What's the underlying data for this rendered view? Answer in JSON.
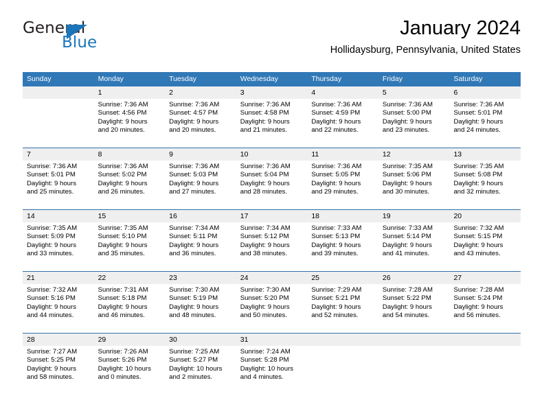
{
  "logo": {
    "word1": "General",
    "word2": "Blue",
    "triangle_color": "#1b75bb"
  },
  "header": {
    "title": "January 2024",
    "subtitle": "Hollidaysburg, Pennsylvania, United States"
  },
  "colors": {
    "header_blue": "#3178b7",
    "row_divider_blue": "#2f6fab",
    "daynum_band": "#efefef",
    "text": "#000000"
  },
  "weekdays": [
    "Sunday",
    "Monday",
    "Tuesday",
    "Wednesday",
    "Thursday",
    "Friday",
    "Saturday"
  ],
  "weeks": [
    [
      {
        "day": "",
        "sunrise": "",
        "sunset": "",
        "daylight1": "",
        "daylight2": ""
      },
      {
        "day": "1",
        "sunrise": "Sunrise: 7:36 AM",
        "sunset": "Sunset: 4:56 PM",
        "daylight1": "Daylight: 9 hours",
        "daylight2": "and 20 minutes."
      },
      {
        "day": "2",
        "sunrise": "Sunrise: 7:36 AM",
        "sunset": "Sunset: 4:57 PM",
        "daylight1": "Daylight: 9 hours",
        "daylight2": "and 20 minutes."
      },
      {
        "day": "3",
        "sunrise": "Sunrise: 7:36 AM",
        "sunset": "Sunset: 4:58 PM",
        "daylight1": "Daylight: 9 hours",
        "daylight2": "and 21 minutes."
      },
      {
        "day": "4",
        "sunrise": "Sunrise: 7:36 AM",
        "sunset": "Sunset: 4:59 PM",
        "daylight1": "Daylight: 9 hours",
        "daylight2": "and 22 minutes."
      },
      {
        "day": "5",
        "sunrise": "Sunrise: 7:36 AM",
        "sunset": "Sunset: 5:00 PM",
        "daylight1": "Daylight: 9 hours",
        "daylight2": "and 23 minutes."
      },
      {
        "day": "6",
        "sunrise": "Sunrise: 7:36 AM",
        "sunset": "Sunset: 5:01 PM",
        "daylight1": "Daylight: 9 hours",
        "daylight2": "and 24 minutes."
      }
    ],
    [
      {
        "day": "7",
        "sunrise": "Sunrise: 7:36 AM",
        "sunset": "Sunset: 5:01 PM",
        "daylight1": "Daylight: 9 hours",
        "daylight2": "and 25 minutes."
      },
      {
        "day": "8",
        "sunrise": "Sunrise: 7:36 AM",
        "sunset": "Sunset: 5:02 PM",
        "daylight1": "Daylight: 9 hours",
        "daylight2": "and 26 minutes."
      },
      {
        "day": "9",
        "sunrise": "Sunrise: 7:36 AM",
        "sunset": "Sunset: 5:03 PM",
        "daylight1": "Daylight: 9 hours",
        "daylight2": "and 27 minutes."
      },
      {
        "day": "10",
        "sunrise": "Sunrise: 7:36 AM",
        "sunset": "Sunset: 5:04 PM",
        "daylight1": "Daylight: 9 hours",
        "daylight2": "and 28 minutes."
      },
      {
        "day": "11",
        "sunrise": "Sunrise: 7:36 AM",
        "sunset": "Sunset: 5:05 PM",
        "daylight1": "Daylight: 9 hours",
        "daylight2": "and 29 minutes."
      },
      {
        "day": "12",
        "sunrise": "Sunrise: 7:35 AM",
        "sunset": "Sunset: 5:06 PM",
        "daylight1": "Daylight: 9 hours",
        "daylight2": "and 30 minutes."
      },
      {
        "day": "13",
        "sunrise": "Sunrise: 7:35 AM",
        "sunset": "Sunset: 5:08 PM",
        "daylight1": "Daylight: 9 hours",
        "daylight2": "and 32 minutes."
      }
    ],
    [
      {
        "day": "14",
        "sunrise": "Sunrise: 7:35 AM",
        "sunset": "Sunset: 5:09 PM",
        "daylight1": "Daylight: 9 hours",
        "daylight2": "and 33 minutes."
      },
      {
        "day": "15",
        "sunrise": "Sunrise: 7:35 AM",
        "sunset": "Sunset: 5:10 PM",
        "daylight1": "Daylight: 9 hours",
        "daylight2": "and 35 minutes."
      },
      {
        "day": "16",
        "sunrise": "Sunrise: 7:34 AM",
        "sunset": "Sunset: 5:11 PM",
        "daylight1": "Daylight: 9 hours",
        "daylight2": "and 36 minutes."
      },
      {
        "day": "17",
        "sunrise": "Sunrise: 7:34 AM",
        "sunset": "Sunset: 5:12 PM",
        "daylight1": "Daylight: 9 hours",
        "daylight2": "and 38 minutes."
      },
      {
        "day": "18",
        "sunrise": "Sunrise: 7:33 AM",
        "sunset": "Sunset: 5:13 PM",
        "daylight1": "Daylight: 9 hours",
        "daylight2": "and 39 minutes."
      },
      {
        "day": "19",
        "sunrise": "Sunrise: 7:33 AM",
        "sunset": "Sunset: 5:14 PM",
        "daylight1": "Daylight: 9 hours",
        "daylight2": "and 41 minutes."
      },
      {
        "day": "20",
        "sunrise": "Sunrise: 7:32 AM",
        "sunset": "Sunset: 5:15 PM",
        "daylight1": "Daylight: 9 hours",
        "daylight2": "and 43 minutes."
      }
    ],
    [
      {
        "day": "21",
        "sunrise": "Sunrise: 7:32 AM",
        "sunset": "Sunset: 5:16 PM",
        "daylight1": "Daylight: 9 hours",
        "daylight2": "and 44 minutes."
      },
      {
        "day": "22",
        "sunrise": "Sunrise: 7:31 AM",
        "sunset": "Sunset: 5:18 PM",
        "daylight1": "Daylight: 9 hours",
        "daylight2": "and 46 minutes."
      },
      {
        "day": "23",
        "sunrise": "Sunrise: 7:30 AM",
        "sunset": "Sunset: 5:19 PM",
        "daylight1": "Daylight: 9 hours",
        "daylight2": "and 48 minutes."
      },
      {
        "day": "24",
        "sunrise": "Sunrise: 7:30 AM",
        "sunset": "Sunset: 5:20 PM",
        "daylight1": "Daylight: 9 hours",
        "daylight2": "and 50 minutes."
      },
      {
        "day": "25",
        "sunrise": "Sunrise: 7:29 AM",
        "sunset": "Sunset: 5:21 PM",
        "daylight1": "Daylight: 9 hours",
        "daylight2": "and 52 minutes."
      },
      {
        "day": "26",
        "sunrise": "Sunrise: 7:28 AM",
        "sunset": "Sunset: 5:22 PM",
        "daylight1": "Daylight: 9 hours",
        "daylight2": "and 54 minutes."
      },
      {
        "day": "27",
        "sunrise": "Sunrise: 7:28 AM",
        "sunset": "Sunset: 5:24 PM",
        "daylight1": "Daylight: 9 hours",
        "daylight2": "and 56 minutes."
      }
    ],
    [
      {
        "day": "28",
        "sunrise": "Sunrise: 7:27 AM",
        "sunset": "Sunset: 5:25 PM",
        "daylight1": "Daylight: 9 hours",
        "daylight2": "and 58 minutes."
      },
      {
        "day": "29",
        "sunrise": "Sunrise: 7:26 AM",
        "sunset": "Sunset: 5:26 PM",
        "daylight1": "Daylight: 10 hours",
        "daylight2": "and 0 minutes."
      },
      {
        "day": "30",
        "sunrise": "Sunrise: 7:25 AM",
        "sunset": "Sunset: 5:27 PM",
        "daylight1": "Daylight: 10 hours",
        "daylight2": "and 2 minutes."
      },
      {
        "day": "31",
        "sunrise": "Sunrise: 7:24 AM",
        "sunset": "Sunset: 5:28 PM",
        "daylight1": "Daylight: 10 hours",
        "daylight2": "and 4 minutes."
      },
      {
        "day": "",
        "sunrise": "",
        "sunset": "",
        "daylight1": "",
        "daylight2": ""
      },
      {
        "day": "",
        "sunrise": "",
        "sunset": "",
        "daylight1": "",
        "daylight2": ""
      },
      {
        "day": "",
        "sunrise": "",
        "sunset": "",
        "daylight1": "",
        "daylight2": ""
      }
    ]
  ]
}
